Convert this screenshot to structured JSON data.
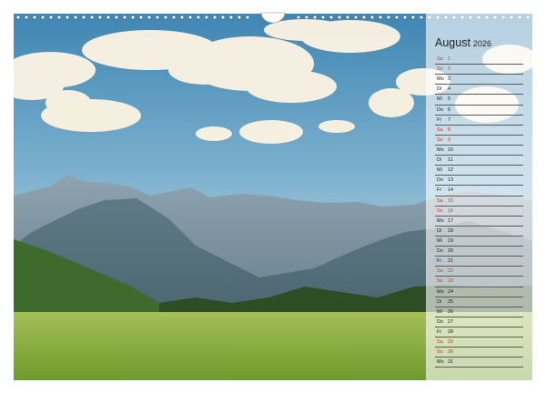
{
  "calendar": {
    "month": "August",
    "year": "2026",
    "days": [
      {
        "weekday": "Sa",
        "day": "1",
        "weekend": true
      },
      {
        "weekday": "So",
        "day": "2",
        "weekend": true
      },
      {
        "weekday": "Mo",
        "day": "3",
        "weekend": false
      },
      {
        "weekday": "Di",
        "day": "4",
        "weekend": false
      },
      {
        "weekday": "Mi",
        "day": "5",
        "weekend": false
      },
      {
        "weekday": "Do",
        "day": "6",
        "weekend": false
      },
      {
        "weekday": "Fr",
        "day": "7",
        "weekend": false
      },
      {
        "weekday": "Sa",
        "day": "8",
        "weekend": true
      },
      {
        "weekday": "So",
        "day": "9",
        "weekend": true
      },
      {
        "weekday": "Mo",
        "day": "10",
        "weekend": false
      },
      {
        "weekday": "Di",
        "day": "11",
        "weekend": false
      },
      {
        "weekday": "Mi",
        "day": "12",
        "weekend": false
      },
      {
        "weekday": "Do",
        "day": "13",
        "weekend": false
      },
      {
        "weekday": "Fr",
        "day": "14",
        "weekend": false
      },
      {
        "weekday": "Sa",
        "day": "15",
        "weekend": true
      },
      {
        "weekday": "So",
        "day": "16",
        "weekend": true
      },
      {
        "weekday": "Mo",
        "day": "17",
        "weekend": false
      },
      {
        "weekday": "Di",
        "day": "18",
        "weekend": false
      },
      {
        "weekday": "Mi",
        "day": "19",
        "weekend": false
      },
      {
        "weekday": "Do",
        "day": "20",
        "weekend": false
      },
      {
        "weekday": "Fr",
        "day": "21",
        "weekend": false
      },
      {
        "weekday": "Sa",
        "day": "22",
        "weekend": true
      },
      {
        "weekday": "So",
        "day": "23",
        "weekend": true
      },
      {
        "weekday": "Mo",
        "day": "24",
        "weekend": false
      },
      {
        "weekday": "Di",
        "day": "25",
        "weekend": false
      },
      {
        "weekday": "Mi",
        "day": "26",
        "weekend": false
      },
      {
        "weekday": "Do",
        "day": "27",
        "weekend": false
      },
      {
        "weekday": "Fr",
        "day": "28",
        "weekend": false
      },
      {
        "weekday": "Sa",
        "day": "29",
        "weekend": true
      },
      {
        "weekday": "So",
        "day": "30",
        "weekend": true
      },
      {
        "weekday": "Mo",
        "day": "31",
        "weekend": false
      }
    ]
  },
  "colors": {
    "weekend_text": "#c0392b",
    "weekday_text": "#222222",
    "sky_top": "#4a8fb8",
    "meadow": "#7fa83a"
  },
  "icons": {
    "binding": "spiral-binding-icon",
    "hanger": "hanger-hole-icon"
  }
}
